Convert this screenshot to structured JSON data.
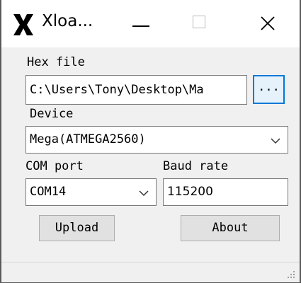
{
  "window": {
    "title": "Xloa...",
    "icon": "x-logo-icon",
    "controls": [
      "minimize-icon",
      "maximize-icon",
      "close-icon"
    ]
  },
  "hex_file": {
    "label": "Hex file",
    "value": "C:\\Users\\Tony\\Desktop\\Ma",
    "browse_label": "..."
  },
  "device": {
    "label": "Device",
    "selected": "Mega(ATMEGA2560)"
  },
  "com_port": {
    "label": "COM port",
    "selected": "COM14"
  },
  "baud_rate": {
    "label": "Baud rate",
    "value": "115200"
  },
  "buttons": {
    "upload": "Upload",
    "about": "About"
  },
  "colors": {
    "focus_border": "#0078d7",
    "button_face": "#e1e1e1",
    "window_bg": "#f0f0f0"
  }
}
